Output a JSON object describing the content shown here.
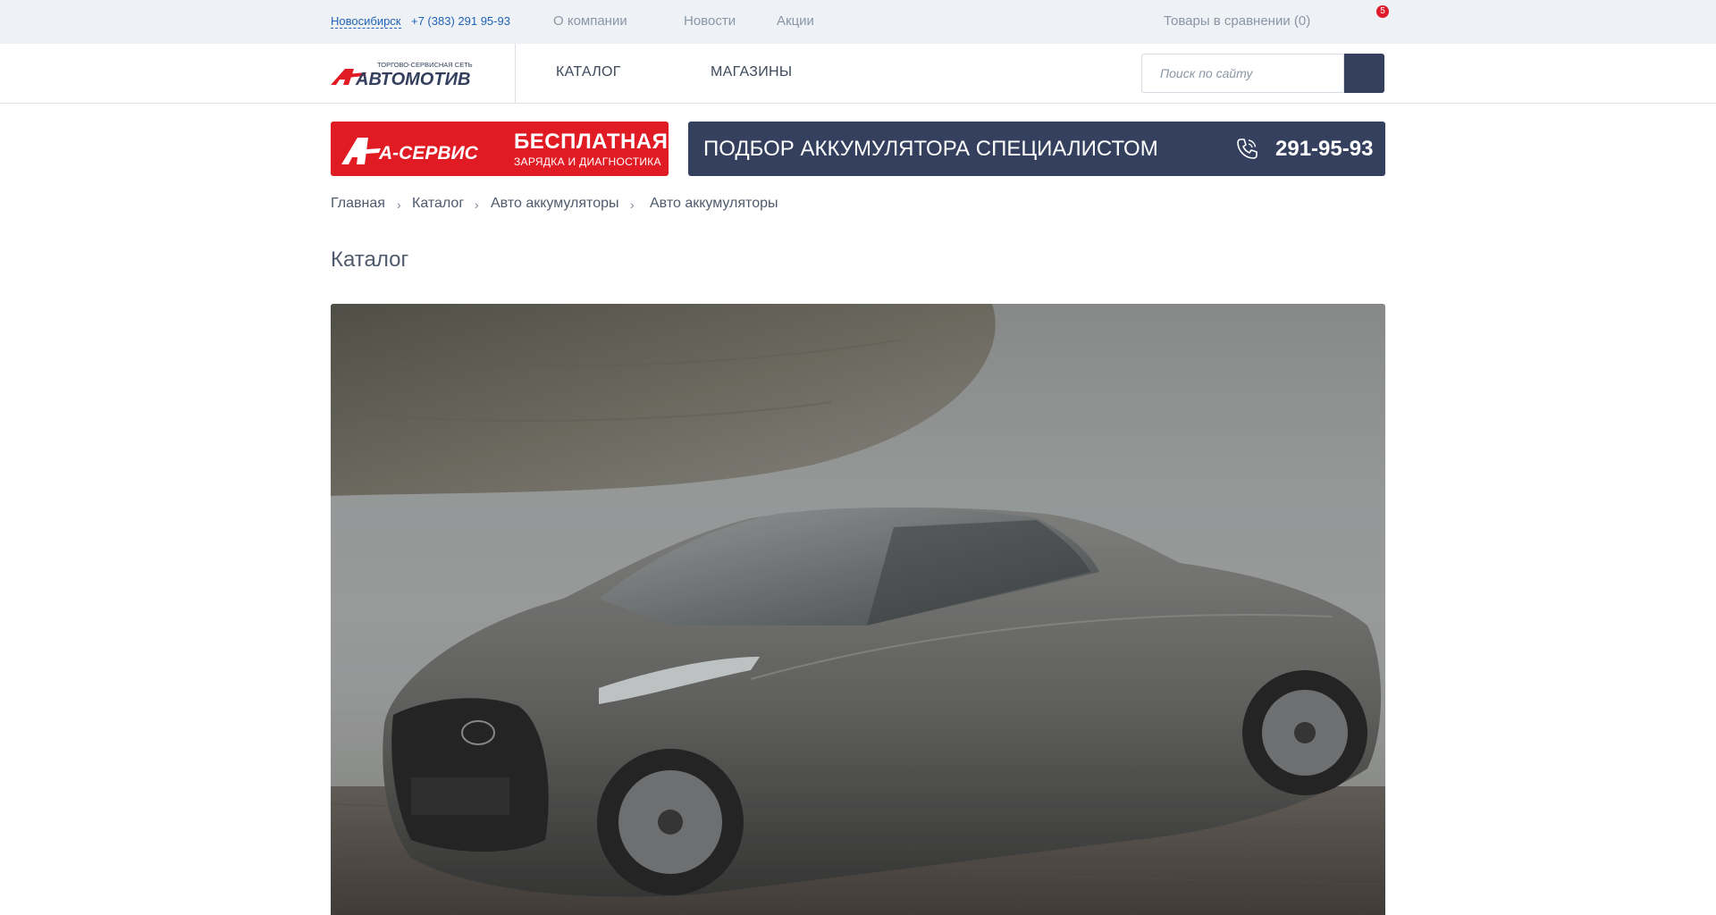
{
  "topbar": {
    "city": "Новосибирск",
    "phone": "+7 (383) 291 95-93",
    "links": [
      "О компании",
      "Новости",
      "Акции"
    ],
    "compare": "Товары в сравнении (0)",
    "cart_count": "5"
  },
  "header": {
    "logo_tagline": "ТОРГОВО-СЕРВИСНАЯ СЕТЬ",
    "logo_name": "АВТОМОТИВ",
    "menu": [
      "КАТАЛОГ",
      "МАГАЗИНЫ"
    ],
    "search_placeholder": "Поиск по сайту"
  },
  "promo_red": {
    "brand": "А-СЕРВИС",
    "title": "БЕСПЛАТНАЯ",
    "subtitle": "ЗАРЯДКА И ДИАГНОСТИКА"
  },
  "promo_blue": {
    "label": "ПОДБОР АККУМУЛЯТОРА СПЕЦИАЛИСТОМ",
    "phone": "291-95-93"
  },
  "breadcrumb": [
    "Главная",
    "Каталог",
    "Авто аккумуляторы",
    "Авто аккумуляторы"
  ],
  "page_title": "Каталог",
  "colors": {
    "accent_blue": "#34405e",
    "accent_red": "#e01b24",
    "link_blue": "#1f63b8"
  }
}
